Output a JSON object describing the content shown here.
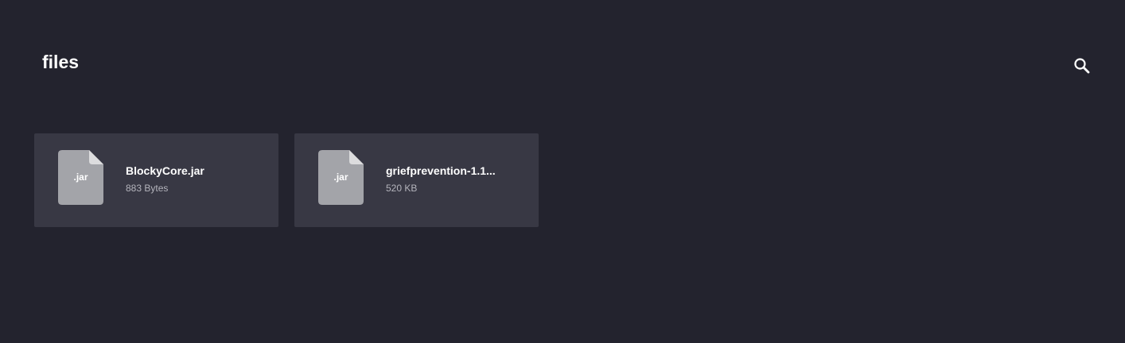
{
  "header": {
    "title": "files",
    "search_icon": "search-icon"
  },
  "files": [
    {
      "name": "BlockyCore.jar",
      "size": "883 Bytes",
      "extension": ".jar",
      "icon": "file-icon"
    },
    {
      "name": "griefprevention-1.1...",
      "size": "520 KB",
      "extension": ".jar",
      "icon": "file-icon"
    }
  ],
  "colors": {
    "background": "#23232e",
    "card": "#383844",
    "file_icon": "#a3a4a9",
    "file_icon_fold": "#dcdcde",
    "text_primary": "#ffffff",
    "text_secondary": "#b4b4bc"
  }
}
